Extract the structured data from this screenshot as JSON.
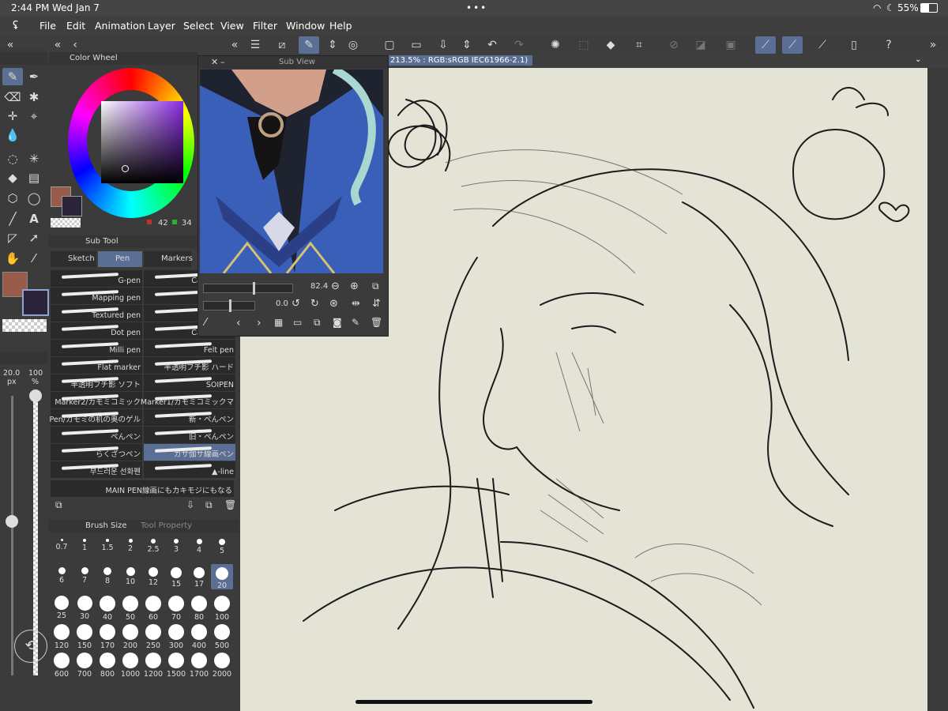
{
  "status": {
    "time": "2:44 PM",
    "date": "Wed Jan 7",
    "battery": "55%"
  },
  "menu": [
    "File",
    "Edit",
    "Animation",
    "Layer",
    "Select",
    "View",
    "Filter",
    "Window",
    "Help"
  ],
  "color_wheel": {
    "title": "Color Wheel",
    "r": "42",
    "g": "34",
    "main_color": "#9a5c4a",
    "sub_color": "#2b2438"
  },
  "subview": {
    "title": "Sub View",
    "zoom": "82.4",
    "rotate": "0.0"
  },
  "canvas": {
    "info": "213.5% : RGB:sRGB IEC61966-2.1)"
  },
  "subtool": {
    "title": "Sub Tool",
    "tabs": [
      "Sketch",
      "Pen",
      "Markers"
    ],
    "brushes": [
      [
        "G-pen",
        "Calligraphy"
      ],
      [
        "Mapping pen",
        ""
      ],
      [
        "Textured pen",
        ""
      ],
      [
        "Dot pen",
        "Calligraphy"
      ],
      [
        "Milli pen",
        "Felt pen"
      ],
      [
        "Flat marker",
        "半透明フチ影 ハード"
      ],
      [
        "半透明フチ影 ソフト",
        "SOIPEN"
      ],
      [
        "Marker2/カモミコミック",
        "Marker1/カモミコミックマ"
      ],
      [
        "Pen/カモミの机の奥のゲル",
        "新・ぺんペン"
      ],
      [
        "ぺんペン",
        "旧・ぺんペン"
      ],
      [
        "らくざつペン",
        "ガサ伽サ線画ペン"
      ],
      [
        "부드러운 선화펜",
        "▲-line"
      ]
    ],
    "wide": "MAIN PEN線画にもカキモジにもなる"
  },
  "brush_size": {
    "title": "Brush Size",
    "tab2": "Tool Property",
    "sizes": [
      "0.7",
      "1",
      "1.5",
      "2",
      "2.5",
      "3",
      "4",
      "5",
      "6",
      "7",
      "8",
      "10",
      "12",
      "15",
      "17",
      "20",
      "25",
      "30",
      "40",
      "50",
      "60",
      "70",
      "80",
      "100",
      "120",
      "150",
      "170",
      "200",
      "250",
      "300",
      "400",
      "500",
      "600",
      "700",
      "800",
      "1000",
      "1200",
      "1500",
      "1700",
      "2000"
    ],
    "selected": "20"
  },
  "props": {
    "size": "20.0",
    "size_unit": "px",
    "opacity": "100",
    "opacity_unit": "%",
    "size_level": 0.55,
    "opacity_level": 1.0
  }
}
